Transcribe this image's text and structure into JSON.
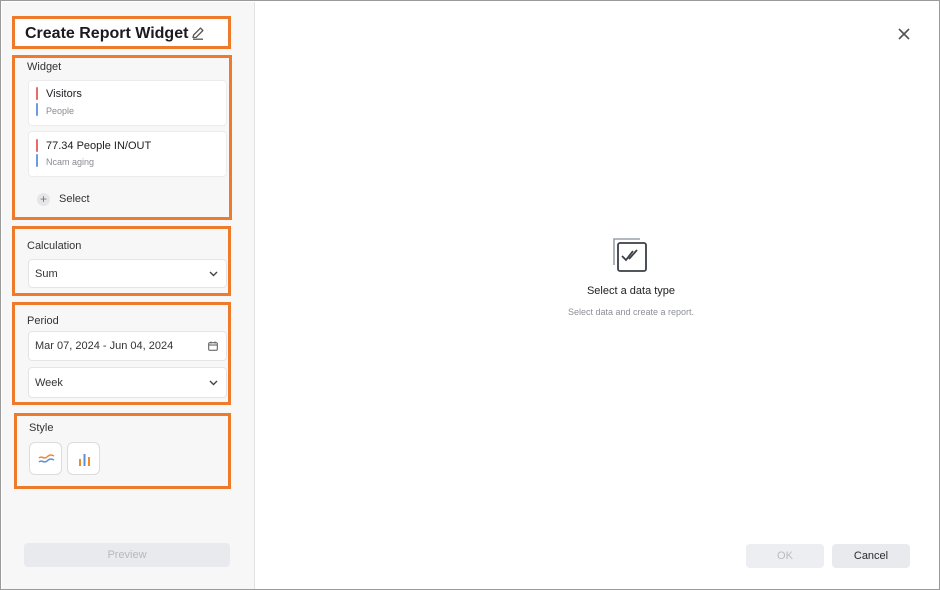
{
  "header": {
    "title": "Create Report Widget",
    "edit_icon": "pencil-icon"
  },
  "widget": {
    "label": "Widget",
    "items": [
      {
        "title": "Visitors",
        "subtitle": "People"
      },
      {
        "title": "77.34 People IN/OUT",
        "subtitle": "Ncam aging"
      }
    ],
    "select_label": "Select"
  },
  "calculation": {
    "label": "Calculation",
    "value": "Sum"
  },
  "period": {
    "label": "Period",
    "date_range": "Mar 07, 2024 - Jun 04, 2024",
    "interval": "Week"
  },
  "style": {
    "label": "Style",
    "options": [
      "line-chart-icon",
      "bar-chart-icon"
    ]
  },
  "footer": {
    "preview_label": "Preview",
    "ok_label": "OK",
    "cancel_label": "Cancel"
  },
  "empty_state": {
    "title": "Select a data type",
    "subtitle": "Select data and create a report."
  },
  "colors": {
    "highlight": "#ee7a2c",
    "red_bar": "#e86a6a",
    "blue_bar": "#6d9be0",
    "orange": "#f08a2c",
    "blue": "#5b8fd9"
  }
}
